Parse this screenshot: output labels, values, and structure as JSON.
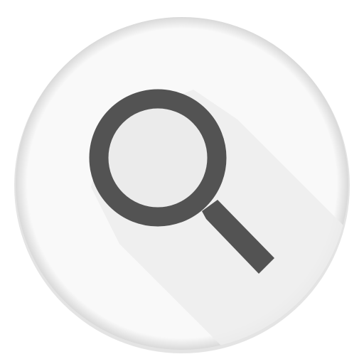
{
  "app_icon": {
    "icon": "search-icon",
    "colors": {
      "circle_background": "#f9f9f9",
      "circle_edge_shadow": "#d9d9d9",
      "long_shadow": "#ededed",
      "lens_fill": "#ebebeb",
      "magnifier_stroke": "#535353"
    }
  }
}
